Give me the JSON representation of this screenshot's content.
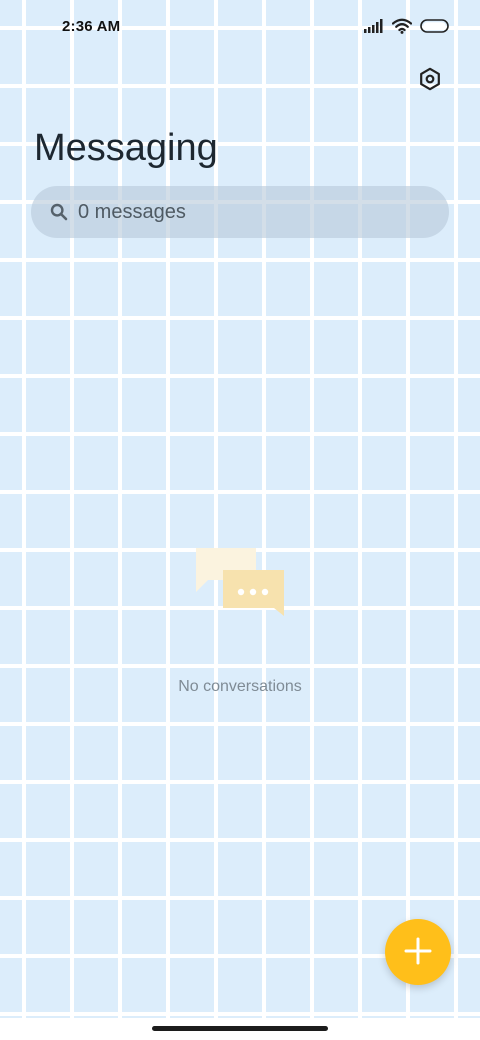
{
  "status_bar": {
    "time": "2:36 AM",
    "icons": [
      "signal-icon",
      "wifi-icon",
      "battery-icon"
    ]
  },
  "header": {
    "title": "Messaging",
    "settings_icon": "gear-icon"
  },
  "search": {
    "placeholder": "0 messages",
    "icon": "search-icon"
  },
  "empty_state": {
    "illustration": "chat-bubbles-icon",
    "message": "No conversations"
  },
  "fab": {
    "icon": "plus-icon",
    "color": "#ffbf1a"
  },
  "colors": {
    "background": "#dcedfb",
    "grid": "#ffffff",
    "accent": "#ffbf1a"
  }
}
